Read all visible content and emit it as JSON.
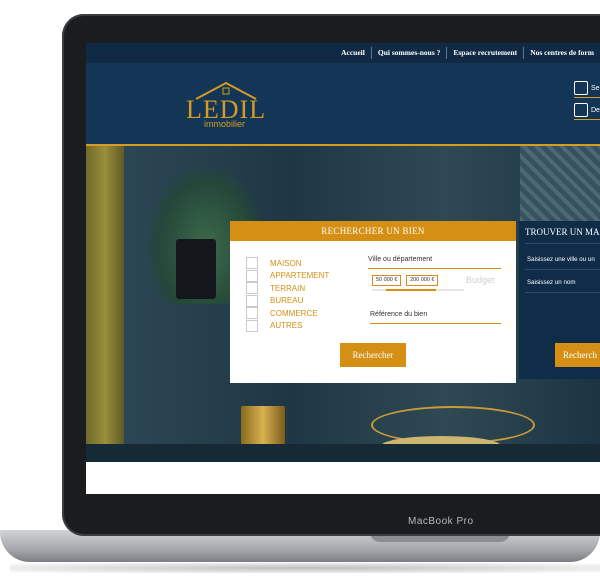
{
  "device": {
    "label": "MacBook Pro"
  },
  "topbar": {
    "items": [
      "Accueil",
      "Qui sommes-nous ?",
      "Espace recrutement",
      "Nos centres de form"
    ]
  },
  "header": {
    "logo_text": "LEDIL",
    "logo_sub": "immobilier",
    "link1": "Se",
    "link2": "De"
  },
  "search": {
    "title": "RECHERCHER UN BIEN",
    "types": [
      "MAISON",
      "APPARTEMENT",
      "TERRAIN",
      "BUREAU",
      "COMMERCE",
      "AUTRES"
    ],
    "location_placeholder": "Ville ou département",
    "budget_min": "50 000 €",
    "budget_max": "200 000 €",
    "budget_label": "Budget",
    "reference_placeholder": "Référence du bien",
    "button": "Rechercher"
  },
  "find": {
    "title": "TROUVER UN MA",
    "field1": "Saisissez une ville ou un",
    "field2": "Saisissez un nom",
    "button": "Recherch"
  },
  "colors": {
    "navy": "#133556",
    "gold": "#d48f14"
  }
}
